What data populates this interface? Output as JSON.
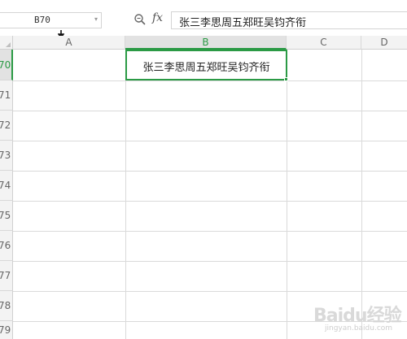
{
  "formula_bar": {
    "name_box": "B70",
    "fx_label": "fx",
    "formula": "张三李思周五郑旺吴钧齐衔"
  },
  "columns": [
    {
      "label": "A",
      "selected": false
    },
    {
      "label": "B",
      "selected": true
    },
    {
      "label": "C",
      "selected": false
    },
    {
      "label": "D",
      "selected": false
    }
  ],
  "rows": [
    {
      "label": "70",
      "selected": true
    },
    {
      "label": "71",
      "selected": false
    },
    {
      "label": "72",
      "selected": false
    },
    {
      "label": "73",
      "selected": false
    },
    {
      "label": "74",
      "selected": false
    },
    {
      "label": "75",
      "selected": false
    },
    {
      "label": "76",
      "selected": false
    },
    {
      "label": "77",
      "selected": false
    },
    {
      "label": "78",
      "selected": false
    },
    {
      "label": "79",
      "selected": false
    }
  ],
  "active_cell": {
    "value": "张三李思周五郑旺吴钧齐衔"
  },
  "watermark": {
    "text": "Baidu经验",
    "sub": "jingyan.baidu.com"
  },
  "colors": {
    "accent": "#2b9a45",
    "header_bg": "#f3f3f3",
    "grid_line": "#dadada"
  }
}
